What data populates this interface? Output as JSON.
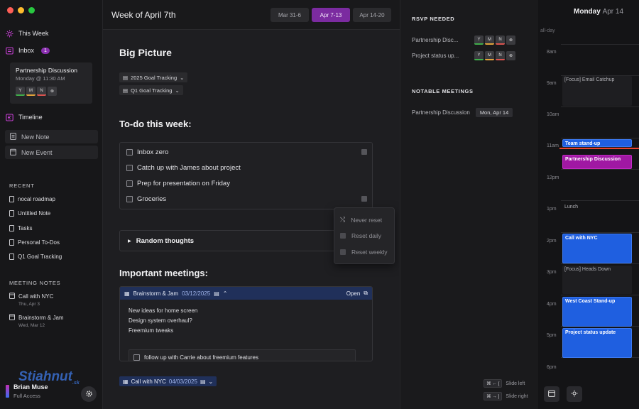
{
  "sidebar": {
    "this_week": "This Week",
    "inbox": "Inbox",
    "inbox_count": "1",
    "inbox_card": {
      "title": "Partnership Discussion",
      "subtitle": "Monday @ 11:30 AM",
      "rsvp": [
        "Y",
        "M",
        "N"
      ]
    },
    "timeline": "Timeline",
    "new_note": "New Note",
    "new_event": "New Event",
    "recent_head": "RECENT",
    "recent": [
      "nocal roadmap",
      "Untitled Note",
      "Tasks",
      "Personal To-Dos",
      "Q1 Goal Tracking"
    ],
    "meeting_head": "MEETING NOTES",
    "meetings": [
      {
        "title": "Call with NYC",
        "date": "Thu, Apr 3"
      },
      {
        "title": "Brainstorm & Jam",
        "date": "Wed, Mar 12"
      }
    ],
    "user_name": "Brian Muse",
    "user_role": "Full Access",
    "watermark": "Stiahnut",
    "watermark_sub": ".sk"
  },
  "main": {
    "title": "Week of April 7th",
    "weeks": [
      "Mar 31-6",
      "Apr 7-13",
      "Apr 14-20"
    ],
    "big_picture": "Big Picture",
    "goal_chips": [
      "2025 Goal Tracking",
      "Q1 Goal Tracking"
    ],
    "todo_heading": "To-do this week:",
    "todos": [
      "Inbox zero",
      "Catch up with James about project",
      "Prep for presentation on Friday",
      "Groceries"
    ],
    "dropdown": [
      "Never reset",
      "Reset daily",
      "Reset weekly"
    ],
    "random_thoughts": "Random thoughts",
    "meetings_heading": "Important meetings:",
    "meeting_card": {
      "title": "Brainstorm & Jam",
      "date": "03/12/2025",
      "open": "Open",
      "notes": [
        "New ideas for home screen",
        "Design system overhaul?",
        "Freemium tweaks"
      ],
      "task": "follow up with Carrie about freemium features"
    },
    "meeting_chip": {
      "title": "Call with NYC",
      "date": "04/03/2025"
    }
  },
  "rsvp_panel": {
    "rsvp_head": "RSVP NEEDED",
    "rsvp_items": [
      "Partnership Disc...",
      "Project status up..."
    ],
    "rsvp_labels": [
      "Y",
      "M",
      "N"
    ],
    "notable_head": "NOTABLE MEETINGS",
    "notable": {
      "title": "Partnership Discussion",
      "date": "Mon, Apr 14"
    },
    "shortcuts": [
      {
        "keys": "⌘ ← [",
        "label": "Slide left"
      },
      {
        "keys": "⌘ → ]",
        "label": "Slide right"
      }
    ]
  },
  "calendar": {
    "day": "Monday",
    "date": "Apr 14",
    "allday": "all-day",
    "hours": [
      "8am",
      "9am",
      "10am",
      "11am",
      "12pm",
      "1pm",
      "2pm",
      "3pm",
      "4pm",
      "5pm",
      "6pm"
    ],
    "events": {
      "email": "[Focus] Email Catchup",
      "standup": "Team stand-up",
      "partnership": "Partnership Discussion",
      "lunch": "Lunch",
      "nyc": "Call with NYC",
      "heads_down": "[Focus] Heads Down",
      "west_coast": "West Coast Stand-up",
      "project_status": "Project status update"
    }
  },
  "colors": {
    "accent": "#7b2ba0",
    "event_blue": "#1f5fe0",
    "event_purple": "#a018a3",
    "rsvp_yes": "#3fae4a",
    "rsvp_maybe": "#e0a23a",
    "rsvp_no": "#d9534f"
  }
}
